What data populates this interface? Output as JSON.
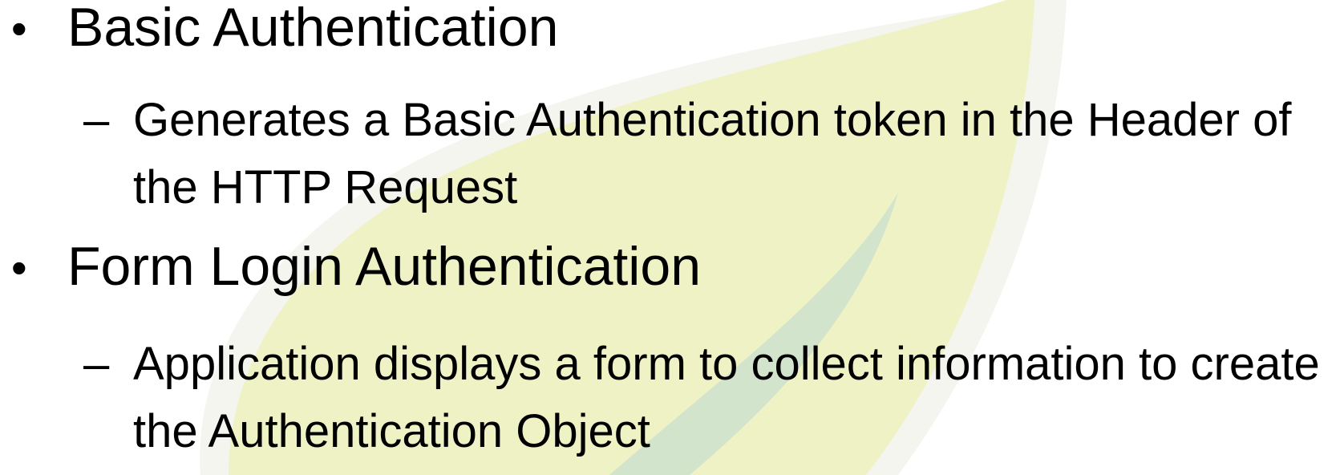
{
  "slide": {
    "bullets": [
      {
        "marker": "•",
        "text": "Basic Authentication",
        "sub": {
          "marker": "–",
          "text": "Generates a Basic Authentication token in the Header of the HTTP Request"
        }
      },
      {
        "marker": "•",
        "text": "Form Login Authentication",
        "sub": {
          "marker": "–",
          "text": "Application displays a form to collect information to create the Authentication Object"
        }
      }
    ]
  },
  "colors": {
    "leaf_fill": "#eef2c4",
    "leaf_outline": "#f3f3f1",
    "leaf_vein": "#cfe3c8",
    "text": "#000000"
  },
  "icons": [
    "leaf-watermark-icon",
    "bullet-dot-icon",
    "dash-icon"
  ]
}
